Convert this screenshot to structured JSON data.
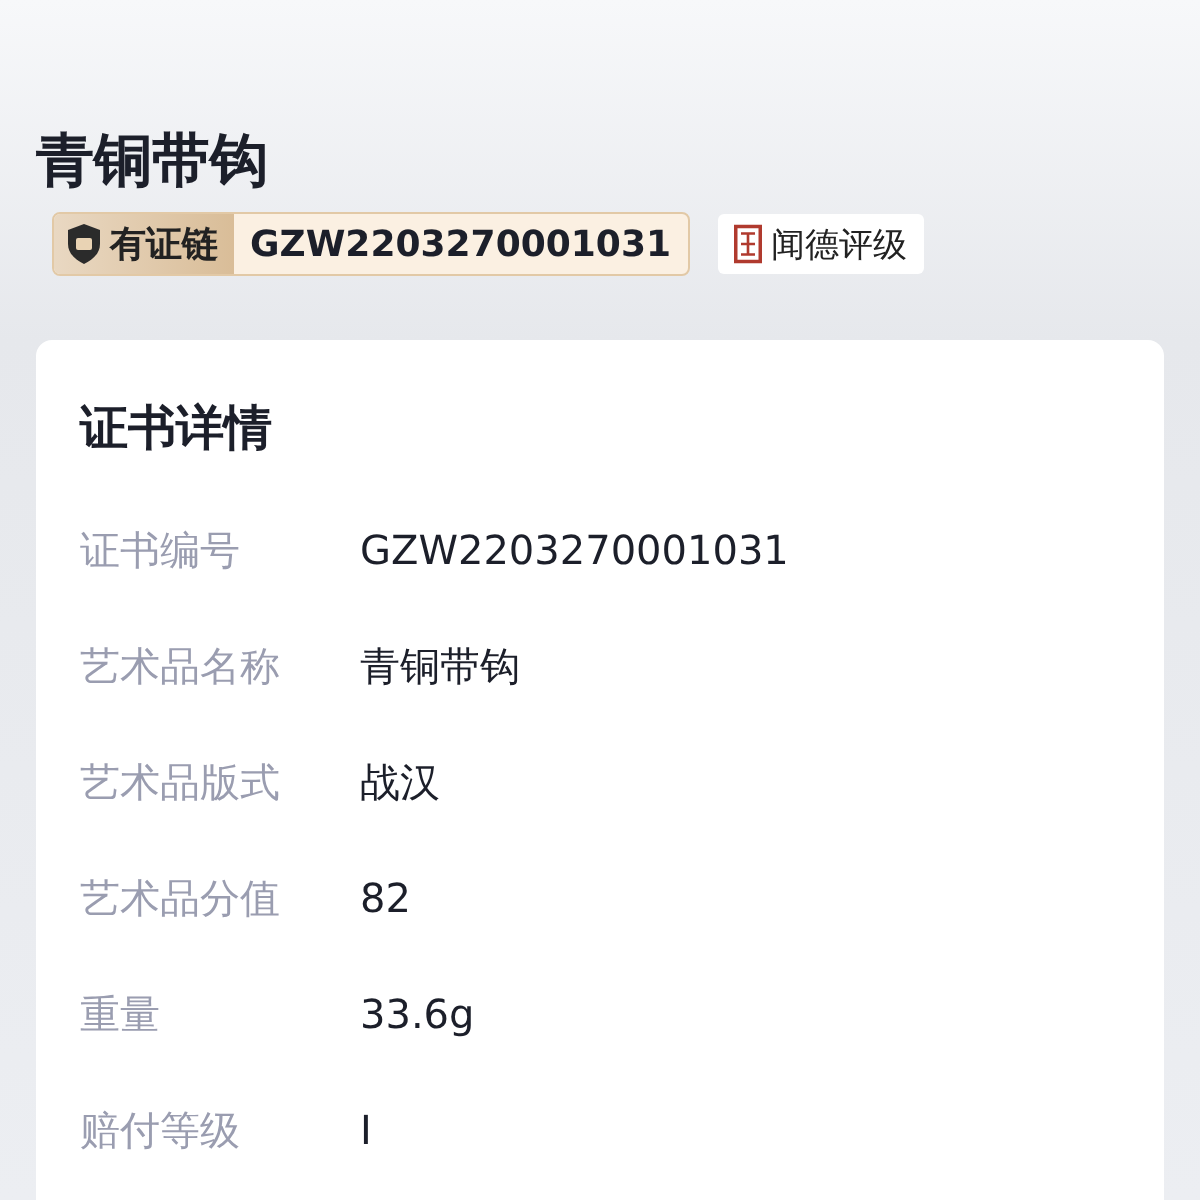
{
  "title": "青铜带钩",
  "chain_badge": {
    "label": "有证链",
    "code": "GZW2203270001031"
  },
  "grading_badge": {
    "label": "闻德评级"
  },
  "card": {
    "heading": "证书详情",
    "rows": [
      {
        "label": "证书编号",
        "value": "GZW2203270001031"
      },
      {
        "label": "艺术品名称",
        "value": "青铜带钩"
      },
      {
        "label": "艺术品版式",
        "value": "战汉"
      },
      {
        "label": "艺术品分值",
        "value": "82"
      },
      {
        "label": "重量",
        "value": "33.6g"
      },
      {
        "label": "赔付等级",
        "value": "I"
      }
    ]
  }
}
